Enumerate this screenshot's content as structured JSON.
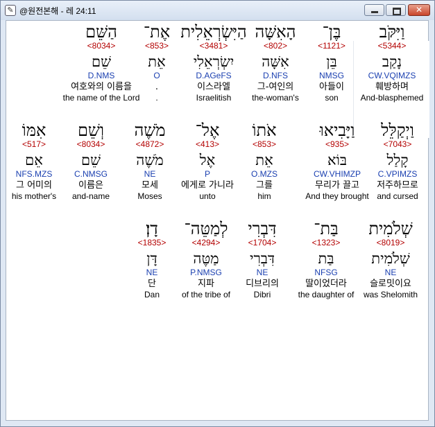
{
  "window": {
    "title": "@원전본해 - 레 24:11",
    "app_icon": "✎",
    "buttons": {
      "minimize": "minimize-icon",
      "maximize": "maximize-icon",
      "close": "close-icon",
      "close_glyph": "✕"
    }
  },
  "rows": [
    {
      "words": [
        {
          "heb": "וַיִּקֹּב",
          "strong": "<5344>",
          "lemma": "נָקַב",
          "morph": "CW.VQIMZS",
          "kor": "훼방하며",
          "eng": "And-blasphemed",
          "selected": true
        },
        {
          "heb": "בֶּן־",
          "strong": "<1121>",
          "lemma": "בֵּן",
          "morph": "NMSG",
          "kor": "아들이",
          "eng": "son"
        },
        {
          "heb": "הָאִשָּׁה",
          "strong": "<802>",
          "lemma": "אִשָּׁה",
          "morph": "D.NFS",
          "kor": "그-여인의",
          "eng": "the-woman's"
        },
        {
          "heb": "הַיִּשְׂרְאֵלִית",
          "strong": "<3481>",
          "lemma": "יִשְׂרְאֵלִי",
          "morph": "D.AGeFS",
          "kor": "이스라엘",
          "eng": "Israelitish"
        },
        {
          "heb": "אֶת־",
          "strong": "<853>",
          "lemma": "אֵת",
          "morph": "O",
          "kor": ".",
          "eng": "."
        },
        {
          "heb": "הַשֵּׁם",
          "strong": "<8034>",
          "lemma": "שֵׁם",
          "morph": "D.NMS",
          "kor": "여호와의 이름을",
          "eng": "the name of the Lord"
        }
      ]
    },
    {
      "words": [
        {
          "heb": "וַיְקַלֵּל",
          "strong": "<7043>",
          "lemma": "קָלַל",
          "morph": "C.VPIMZS",
          "kor": "저주하므로",
          "eng": "and cursed"
        },
        {
          "heb": "וַיָּבִיאוּ",
          "strong": "<935>",
          "lemma": "בּוֹא",
          "morph": "CW.VHIMZP",
          "kor": "무리가 끌고",
          "eng": "And they brought"
        },
        {
          "heb": "אֹתוֹ",
          "strong": "<853>",
          "lemma": "אֵת",
          "morph": "O.MZS",
          "kor": "그를",
          "eng": "him"
        },
        {
          "heb": "אֶל־",
          "strong": "<413>",
          "lemma": "אֶל",
          "morph": "P",
          "kor": "에게로 가니라",
          "eng": "unto"
        },
        {
          "heb": "מֹשֶׁה",
          "strong": "<4872>",
          "lemma": "מֹשֶׁה",
          "morph": "NE",
          "kor": "모세",
          "eng": "Moses"
        },
        {
          "heb": "וְשֵׁם",
          "strong": "<8034>",
          "lemma": "שֵׁם",
          "morph": "C.NMSG",
          "kor": "이름은",
          "eng": "and-name"
        },
        {
          "heb": "אִמּוֹ",
          "strong": "<517>",
          "lemma": "אֵם",
          "morph": "NFS.MZS",
          "kor": "그 어미의",
          "eng": "his mother's"
        }
      ]
    },
    {
      "words": [
        {
          "heb": "שְׁלֹמִית",
          "strong": "<8019>",
          "lemma": "שְׁלֹמִית",
          "morph": "NE",
          "kor": "슬로밋이요",
          "eng": "was Shelomith"
        },
        {
          "heb": "בַּת־",
          "strong": "<1323>",
          "lemma": "בַּת",
          "morph": "NFSG",
          "kor": "딸이었더라",
          "eng": "the daughter of"
        },
        {
          "heb": "דִּבְרִי",
          "strong": "<1704>",
          "lemma": "דִּבְרִי",
          "morph": "NE",
          "kor": "디브리의",
          "eng": "Dibri"
        },
        {
          "heb": "לְמַטֵּה־",
          "strong": "<4294>",
          "lemma": "מַטֶּה",
          "morph": "P.NMSG",
          "kor": "지파",
          "eng": "of the tribe of"
        },
        {
          "heb": "דָן׃",
          "strong": "<1835>",
          "lemma": "דָּן",
          "morph": "NE",
          "kor": "단",
          "eng": "Dan"
        }
      ]
    }
  ]
}
